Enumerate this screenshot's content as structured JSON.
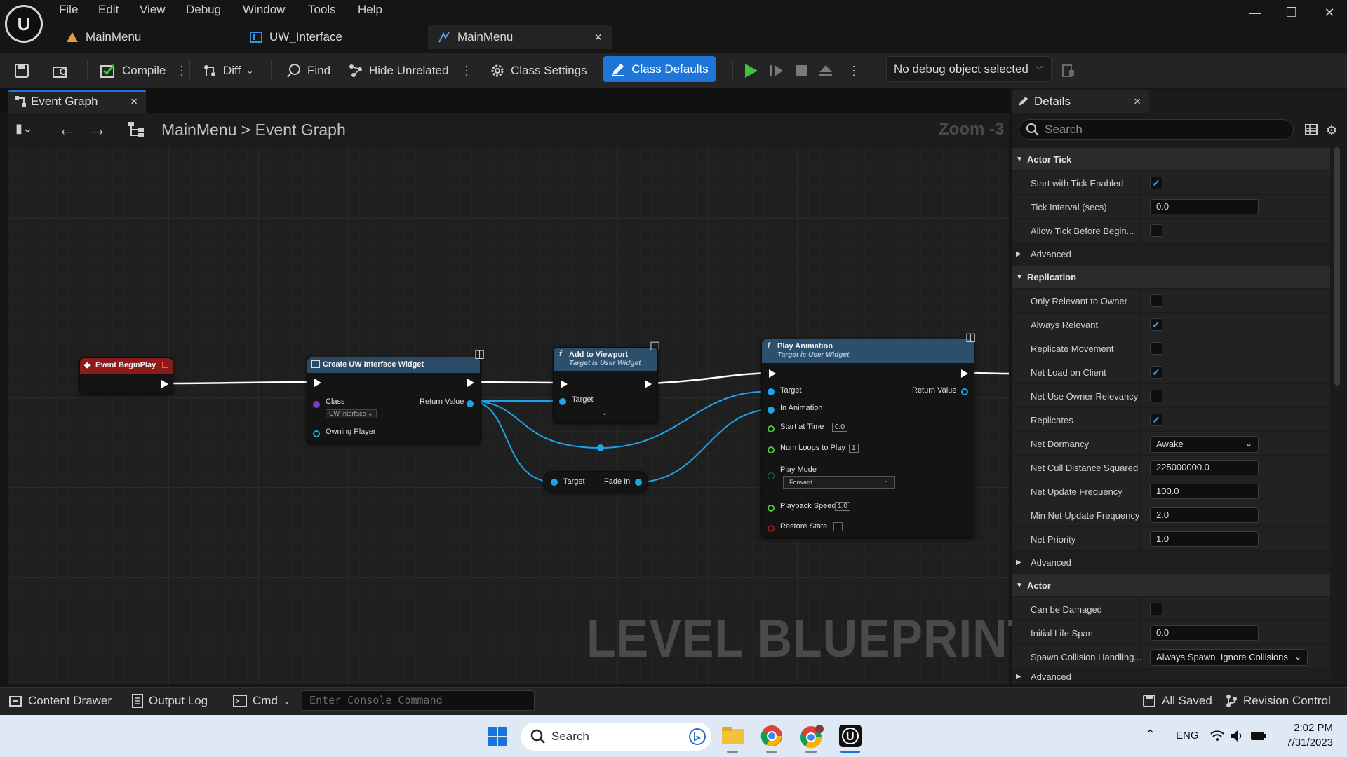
{
  "menu": [
    "File",
    "Edit",
    "View",
    "Debug",
    "Window",
    "Tools",
    "Help"
  ],
  "doc_tabs": [
    {
      "label": "MainMenu"
    },
    {
      "label": "UW_Interface"
    },
    {
      "label": "MainMenu",
      "close": "×"
    }
  ],
  "toolbar": {
    "compile": "Compile",
    "diff": "Diff",
    "find": "Find",
    "hide_unrelated": "Hide Unrelated",
    "class_settings": "Class Settings",
    "class_defaults": "Class Defaults",
    "debug_select": "No debug object selected"
  },
  "graph_tab": {
    "label": "Event Graph",
    "close": "×"
  },
  "breadcrumb": {
    "root": "MainMenu",
    "sep": ">",
    "current": "Event Graph"
  },
  "zoom": "Zoom -3",
  "watermark": "LEVEL BLUEPRINT",
  "nodes": {
    "begin_play": {
      "title": "Event BeginPlay"
    },
    "create_widget": {
      "title": "Create UW Interface Widget",
      "class_label": "Class",
      "class_value": "UW Interface",
      "owning_player": "Owning Player",
      "return_value": "Return Value"
    },
    "add_viewport": {
      "title": "Add to Viewport",
      "subtitle": "Target is User Widget",
      "target": "Target"
    },
    "fade_in": {
      "target": "Target",
      "output": "Fade In"
    },
    "play_anim": {
      "title": "Play Animation",
      "subtitle": "Target is User Widget",
      "target": "Target",
      "return_value": "Return Value",
      "in_animation": "In Animation",
      "start_at_time": "Start at Time",
      "start_at_time_value": "0.0",
      "num_loops": "Num Loops to Play",
      "num_loops_value": "1",
      "play_mode": "Play Mode",
      "play_mode_value": "Forward",
      "playback_speed": "Playback Speed",
      "playback_speed_value": "1.0",
      "restore_state": "Restore State"
    }
  },
  "details": {
    "tab": "Details",
    "tab_close": "×",
    "search_placeholder": "Search",
    "categories": {
      "actor_tick": "Actor Tick",
      "replication": "Replication",
      "actor": "Actor",
      "advanced": "Advanced"
    },
    "props": {
      "start_tick": "Start with Tick Enabled",
      "tick_interval": "Tick Interval (secs)",
      "tick_interval_value": "0.0",
      "allow_tick": "Allow Tick Before Begin...",
      "only_relevant": "Only Relevant to Owner",
      "always_relevant": "Always Relevant",
      "replicate_movement": "Replicate Movement",
      "net_load": "Net Load on Client",
      "net_use_owner": "Net Use Owner Relevancy",
      "replicates": "Replicates",
      "net_dormancy": "Net Dormancy",
      "net_dormancy_value": "Awake",
      "net_cull": "Net Cull Distance Squared",
      "net_cull_value": "225000000.0",
      "net_update": "Net Update Frequency",
      "net_update_value": "100.0",
      "min_net_update": "Min Net Update Frequency",
      "min_net_update_value": "2.0",
      "net_priority": "Net Priority",
      "net_priority_value": "1.0",
      "can_be_damaged": "Can be Damaged",
      "initial_life": "Initial Life Span",
      "initial_life_value": "0.0",
      "spawn_collision": "Spawn Collision Handling...",
      "spawn_collision_value": "Always Spawn, Ignore Collisions"
    },
    "checkmark": "✓"
  },
  "bottom": {
    "content_drawer": "Content Drawer",
    "output_log": "Output Log",
    "cmd": "Cmd",
    "console_placeholder": "Enter Console Command",
    "all_saved": "All Saved",
    "revision_control": "Revision Control"
  },
  "taskbar": {
    "search": "Search",
    "lang": "ENG",
    "time": "2:02 PM",
    "date": "7/31/2023"
  },
  "colors": {
    "accent": "#1d76d8",
    "exec_wire": "#ffffff",
    "object_wire": "#1fa3e8"
  }
}
